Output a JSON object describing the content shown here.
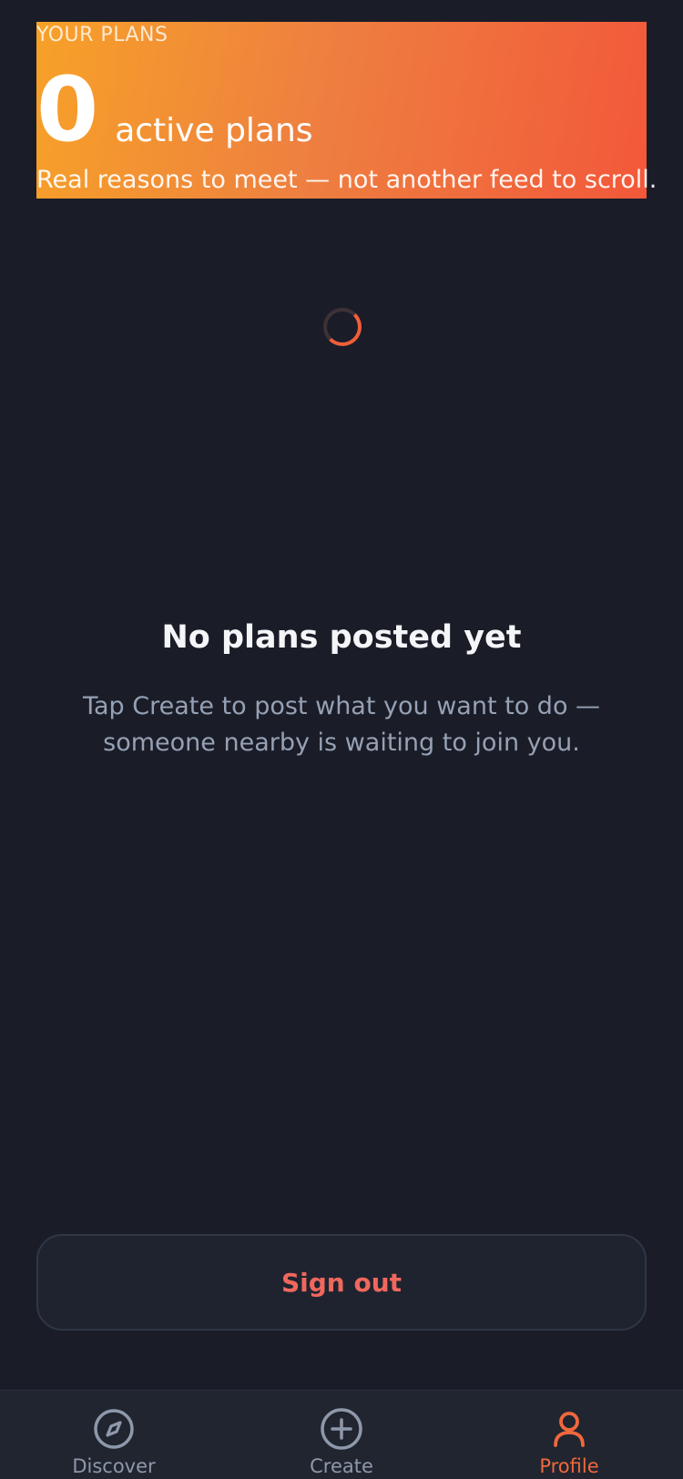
{
  "hero": {
    "eyebrow": "YOUR PLANS",
    "count": "0",
    "count_label": "active plans",
    "tagline": "Real reasons to meet — not another feed to scroll."
  },
  "empty_state": {
    "title": "No plans posted yet",
    "description": "Tap Create to post what you want to do — someone nearby is waiting to join you."
  },
  "actions": {
    "sign_out_label": "Sign out"
  },
  "tabbar": {
    "tabs": [
      {
        "label": "Discover",
        "icon": "compass-icon",
        "active": false
      },
      {
        "label": "Create",
        "icon": "plus-circle-icon",
        "active": false
      },
      {
        "label": "Profile",
        "icon": "user-icon",
        "active": true
      }
    ]
  },
  "colors": {
    "background": "#1a1d27",
    "accent": "#f0683c",
    "gradient_start": "#f7a128",
    "gradient_end": "#f2583a",
    "danger_text": "#f0685c",
    "muted_text": "#96a1b5"
  }
}
